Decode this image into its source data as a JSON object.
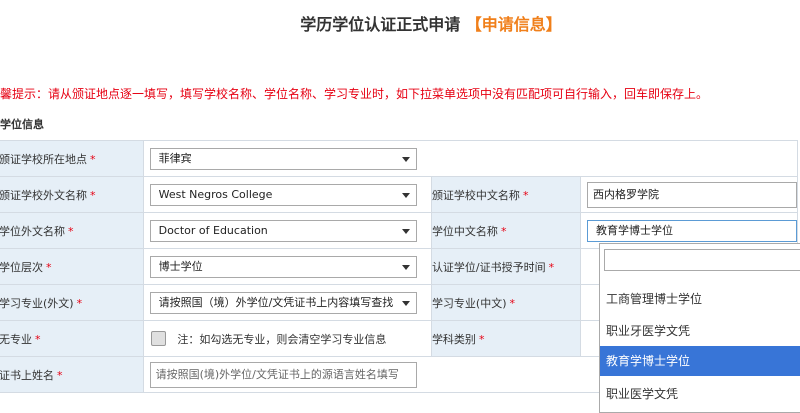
{
  "header": {
    "title": "学历学位认证正式申请",
    "highlight": "【申请信息】"
  },
  "tip": "馨提示：请从颁证地点逐一填写，填写学校名称、学位名称、学习专业时，如下拉菜单选项中没有匹配项可自行输入，回车即保存上。",
  "section": {
    "title": "学位信息"
  },
  "required_mark": "*",
  "rows": {
    "location": {
      "label": "颁证学校所在地点",
      "value": "菲律宾"
    },
    "school_foreign": {
      "label": "颁证学校外文名称",
      "value": "West Negros College"
    },
    "school_chinese": {
      "label": "颁证学校中文名称",
      "value": "西内格罗学院"
    },
    "degree_foreign": {
      "label": "学位外文名称",
      "value": "Doctor of Education"
    },
    "degree_chinese": {
      "label": "学位中文名称",
      "value": "教育学博士学位"
    },
    "level": {
      "label": "学位层次",
      "value": "博士学位"
    },
    "award_time": {
      "label": "认证学位/证书授予时间"
    },
    "major_foreign": {
      "label": "学习专业(外文)",
      "value": "请按照国（境）外学位/文凭证书上内容填写查找"
    },
    "major_chinese": {
      "label": "学习专业(中文)"
    },
    "no_major": {
      "label": "无专业",
      "note": "注：如勾选无专业，则会清空学习专业信息"
    },
    "category": {
      "label": "学科类别"
    },
    "cert_name": {
      "label": "证书上姓名",
      "placeholder": "请按照国(境)外学位/文凭证书上的源语言姓名填写"
    }
  },
  "degree_dropdown": {
    "options": [
      "工商管理博士学位",
      "职业牙医学文凭",
      "教育学博士学位",
      "职业医学文凭"
    ],
    "active_index": 2
  },
  "colors": {
    "accent": "#f07f1a",
    "warning": "#e60012",
    "label_bg": "#e6eff7",
    "selected": "#3875d7"
  }
}
